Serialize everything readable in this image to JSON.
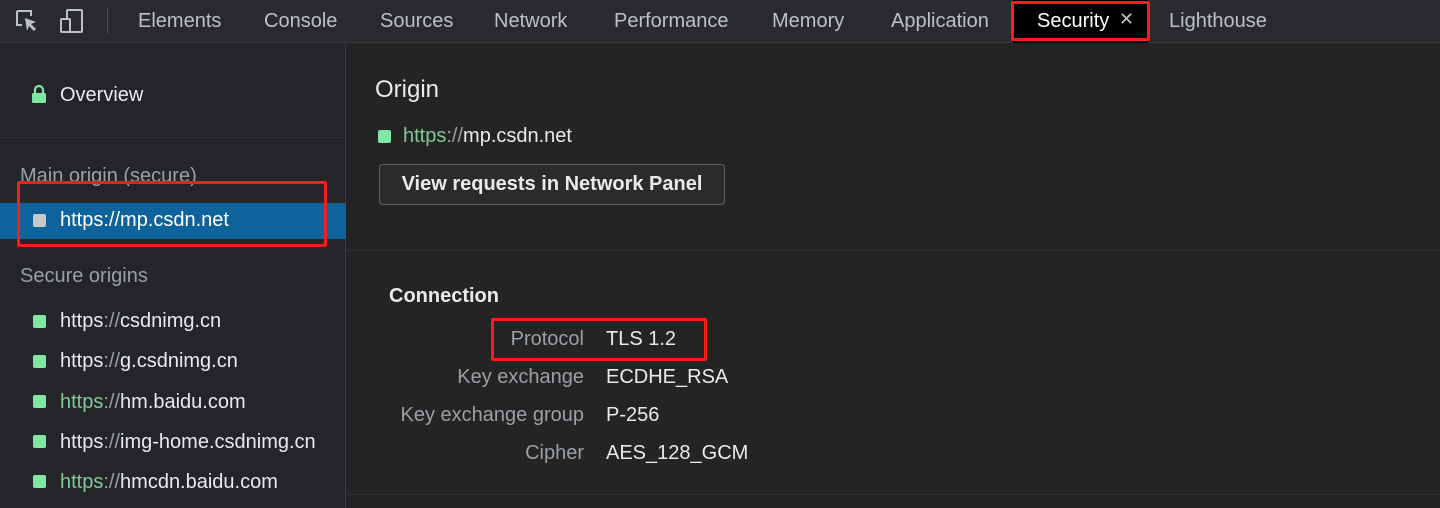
{
  "tabs": [
    {
      "label": "Elements"
    },
    {
      "label": "Console"
    },
    {
      "label": "Sources"
    },
    {
      "label": "Network"
    },
    {
      "label": "Performance"
    },
    {
      "label": "Memory"
    },
    {
      "label": "Application"
    },
    {
      "label": "Security",
      "active": true
    },
    {
      "label": "Lighthouse"
    }
  ],
  "tab_close_glyph": "✕",
  "sidebar": {
    "overview_label": "Overview",
    "main_origin_heading": "Main origin (secure)",
    "main_origin": {
      "scheme": "https",
      "sep": "://",
      "host": "mp.csdn.net"
    },
    "secure_origins_heading": "Secure origins",
    "secure_origins": [
      {
        "scheme": "https",
        "sep": "://",
        "host": "csdnimg.cn"
      },
      {
        "scheme": "https",
        "sep": "://",
        "host": "g.csdnimg.cn"
      },
      {
        "scheme": "https",
        "sep": "://",
        "host": "hm.baidu.com"
      },
      {
        "scheme": "https",
        "sep": "://",
        "host": "img-home.csdnimg.cn"
      },
      {
        "scheme": "https",
        "sep": "://",
        "host": "hmcdn.baidu.com"
      }
    ]
  },
  "main": {
    "origin_title": "Origin",
    "origin_url": {
      "scheme": "https",
      "sep": "://",
      "host": "mp.csdn.net"
    },
    "view_requests_button": "View requests in Network Panel",
    "connection": {
      "title": "Connection",
      "rows": [
        {
          "key": "Protocol",
          "value": "TLS 1.2"
        },
        {
          "key": "Key exchange",
          "value": "ECDHE_RSA"
        },
        {
          "key": "Key exchange group",
          "value": "P-256"
        },
        {
          "key": "Cipher",
          "value": "AES_128_GCM"
        }
      ]
    }
  },
  "colors": {
    "secure_green": "#81e6a3",
    "selection_blue": "#0e639c",
    "highlight_red": "#ff1a1a"
  },
  "icons": [
    "inspect-element-icon",
    "device-toolbar-icon",
    "lock-icon",
    "close-icon"
  ]
}
